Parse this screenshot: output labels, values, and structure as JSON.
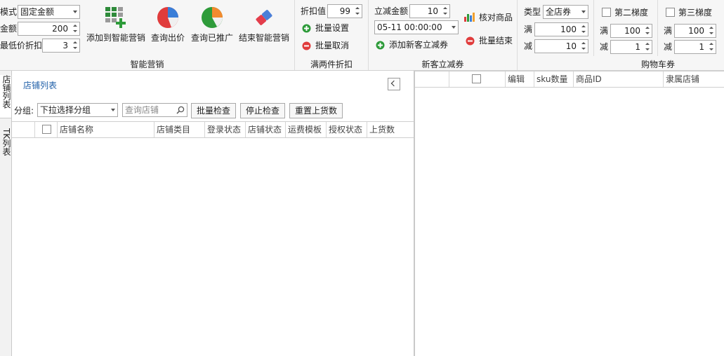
{
  "ribbon": {
    "smart": {
      "mode_label": "模式",
      "mode_value": "固定金额",
      "amount_label": "金额",
      "amount_value": "200",
      "min_discount_label": "最低价折扣",
      "min_discount_value": "3",
      "add_label": "添加到智能营销",
      "query_price_label": "查询出价",
      "query_promoted_label": "查询已推广",
      "end_label": "结束智能营销",
      "caption": "智能营销"
    },
    "two_piece": {
      "discount_label": "折扣值",
      "discount_value": "99",
      "batch_set_label": "批量设置",
      "batch_cancel_label": "批量取消",
      "caption": "满两件折扣"
    },
    "new_customer": {
      "amount_label": "立减金额",
      "amount_value": "10",
      "datetime_value": "05-11 00:00:00",
      "add_label": "添加新客立减券",
      "check_goods_label": "核对商品",
      "batch_end_label": "批量结束",
      "caption": "新客立减券"
    },
    "cart": {
      "type_label": "类型",
      "type_value": "全店券",
      "full_label": "满",
      "full_value": "100",
      "minus_label": "减",
      "minus_value": "10",
      "tier2_label": "第二梯度",
      "tier2_full_value": "100",
      "tier2_minus_value": "1",
      "tier3_label": "第三梯度",
      "tier3_full_value": "100",
      "tier3_minus_value": "1",
      "caption": "购物车券"
    }
  },
  "side_tabs": [
    "店铺列表",
    "TK列表"
  ],
  "left_panel": {
    "title": "店铺列表",
    "group_label": "分组:",
    "group_value": "下拉选择分组",
    "search_placeholder": "查询店铺",
    "check_btn": "批量检查",
    "stop_btn": "停止检查",
    "reset_btn": "重置上货数",
    "columns": [
      "店铺名称",
      "店铺类目",
      "登录状态",
      "店铺状态",
      "运费模板",
      "授权状态",
      "上货数"
    ]
  },
  "right_panel": {
    "columns": [
      "编辑",
      "sku数量",
      "商品ID",
      "隶属店铺"
    ]
  },
  "colors": {
    "accent": "#1f5fa8",
    "green": "#2e9b3a",
    "red": "#e24a4a"
  }
}
